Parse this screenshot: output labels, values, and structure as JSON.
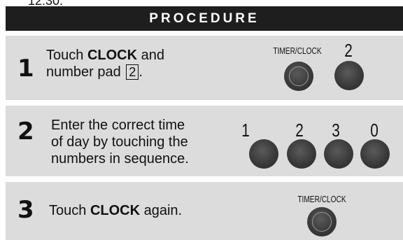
{
  "top_fragment": "12:30.",
  "header": {
    "title": "PROCEDURE"
  },
  "steps": [
    {
      "number": "1",
      "text_parts": [
        "Touch ",
        "CLOCK",
        " and",
        "number pad "
      ],
      "pad_value": "2",
      "pad_suffix": ".",
      "buttons": {
        "timer_clock_label": "TIMER/CLOCK",
        "digit_label": "2"
      }
    },
    {
      "number": "2",
      "lines": [
        "Enter the correct time",
        "of day by touching the",
        "numbers in sequence."
      ],
      "digits": [
        "1",
        "2",
        "3",
        "0"
      ]
    },
    {
      "number": "3",
      "text_parts": [
        "Touch ",
        "CLOCK",
        " again."
      ],
      "buttons": {
        "timer_clock_label": "TIMER/CLOCK"
      }
    }
  ]
}
